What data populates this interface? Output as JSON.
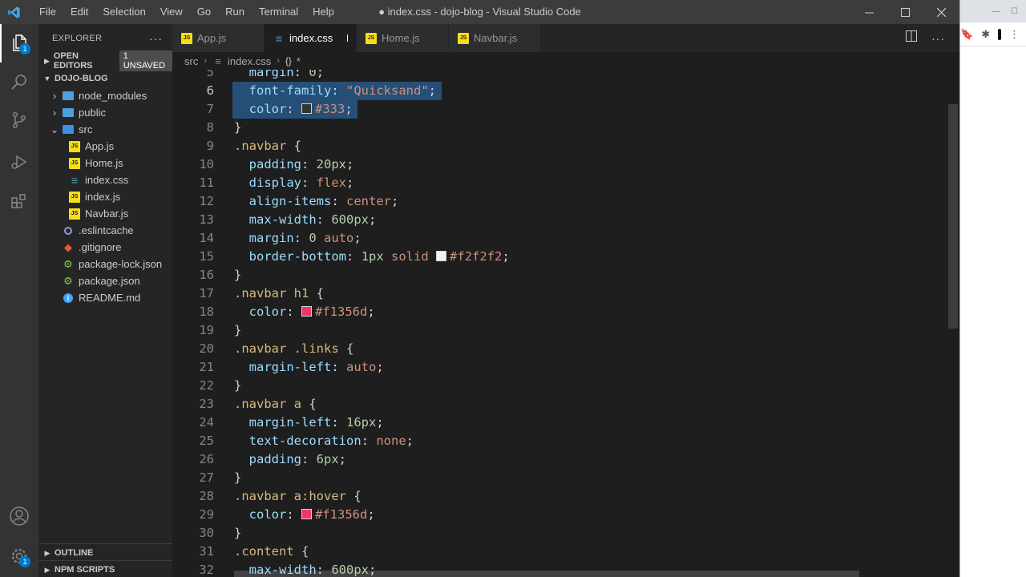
{
  "titlebar": {
    "menu": [
      "File",
      "Edit",
      "Selection",
      "View",
      "Go",
      "Run",
      "Terminal",
      "Help"
    ],
    "title": "● index.css - dojo-blog - Visual Studio Code"
  },
  "activity": {
    "explorer_badge": "1",
    "settings_badge": "1"
  },
  "sidebar": {
    "header": "EXPLORER",
    "open_editors": {
      "label": "OPEN EDITORS",
      "badge": "1 UNSAVED"
    },
    "project": "DOJO-BLOG",
    "tree": [
      {
        "label": "node_modules",
        "type": "folder",
        "depth": 1,
        "chevron": "›"
      },
      {
        "label": "public",
        "type": "folder",
        "depth": 1,
        "chevron": "›"
      },
      {
        "label": "src",
        "type": "folder-src",
        "depth": 1,
        "chevron": "⌄"
      },
      {
        "label": "App.js",
        "type": "js",
        "depth": 2
      },
      {
        "label": "Home.js",
        "type": "js",
        "depth": 2
      },
      {
        "label": "index.css",
        "type": "css",
        "depth": 2
      },
      {
        "label": "index.js",
        "type": "js",
        "depth": 2
      },
      {
        "label": "Navbar.js",
        "type": "js",
        "depth": 2
      },
      {
        "label": ".eslintcache",
        "type": "eslint",
        "depth": 1
      },
      {
        "label": ".gitignore",
        "type": "git",
        "depth": 1
      },
      {
        "label": "package-lock.json",
        "type": "npm",
        "depth": 1
      },
      {
        "label": "package.json",
        "type": "npm",
        "depth": 1
      },
      {
        "label": "README.md",
        "type": "info",
        "depth": 1
      }
    ],
    "outline": "OUTLINE",
    "npm_scripts": "NPM SCRIPTS"
  },
  "tabs": [
    {
      "label": "App.js",
      "type": "js",
      "active": false
    },
    {
      "label": "index.css",
      "type": "css",
      "active": true,
      "dirty": true
    },
    {
      "label": "Home.js",
      "type": "js",
      "active": false
    },
    {
      "label": "Navbar.js",
      "type": "js",
      "active": false
    }
  ],
  "breadcrumb": {
    "folder": "src",
    "file": "index.css",
    "symbol": "*"
  },
  "editor": {
    "current_line": 6,
    "lines": [
      {
        "n": "5",
        "indent": 1,
        "tokens": [
          [
            "prop",
            "margin"
          ],
          [
            "pun",
            ": "
          ],
          [
            "num",
            "0"
          ],
          [
            "pun",
            ";"
          ]
        ]
      },
      {
        "n": "6",
        "indent": 1,
        "sel": true,
        "tokens": [
          [
            "prop",
            "font-family"
          ],
          [
            "pun",
            ": "
          ],
          [
            "str",
            "\"Quicksand\""
          ],
          [
            "pun",
            ";"
          ]
        ]
      },
      {
        "n": "7",
        "indent": 1,
        "sel": true,
        "tokens": [
          [
            "prop",
            "color"
          ],
          [
            "pun",
            ": "
          ],
          [
            "swatch",
            "#333333"
          ],
          [
            "val",
            "#333"
          ],
          [
            "pun",
            ";"
          ]
        ]
      },
      {
        "n": "8",
        "indent": 0,
        "tokens": [
          [
            "pun",
            "}"
          ]
        ]
      },
      {
        "n": "9",
        "indent": 0,
        "tokens": [
          [
            "sel",
            ".navbar"
          ],
          [
            "pun",
            " {"
          ]
        ]
      },
      {
        "n": "10",
        "indent": 1,
        "tokens": [
          [
            "prop",
            "padding"
          ],
          [
            "pun",
            ": "
          ],
          [
            "num",
            "20px"
          ],
          [
            "pun",
            ";"
          ]
        ]
      },
      {
        "n": "11",
        "indent": 1,
        "tokens": [
          [
            "prop",
            "display"
          ],
          [
            "pun",
            ": "
          ],
          [
            "val",
            "flex"
          ],
          [
            "pun",
            ";"
          ]
        ]
      },
      {
        "n": "12",
        "indent": 1,
        "tokens": [
          [
            "prop",
            "align-items"
          ],
          [
            "pun",
            ": "
          ],
          [
            "val",
            "center"
          ],
          [
            "pun",
            ";"
          ]
        ]
      },
      {
        "n": "13",
        "indent": 1,
        "tokens": [
          [
            "prop",
            "max-width"
          ],
          [
            "pun",
            ": "
          ],
          [
            "num",
            "600px"
          ],
          [
            "pun",
            ";"
          ]
        ]
      },
      {
        "n": "14",
        "indent": 1,
        "tokens": [
          [
            "prop",
            "margin"
          ],
          [
            "pun",
            ": "
          ],
          [
            "num",
            "0"
          ],
          [
            "pun",
            " "
          ],
          [
            "val",
            "auto"
          ],
          [
            "pun",
            ";"
          ]
        ]
      },
      {
        "n": "15",
        "indent": 1,
        "tokens": [
          [
            "prop",
            "border-bottom"
          ],
          [
            "pun",
            ": "
          ],
          [
            "num",
            "1px"
          ],
          [
            "pun",
            " "
          ],
          [
            "val",
            "solid"
          ],
          [
            "pun",
            " "
          ],
          [
            "swatch",
            "#f2f2f2"
          ],
          [
            "val",
            "#f2f2f2"
          ],
          [
            "pun",
            ";"
          ]
        ]
      },
      {
        "n": "16",
        "indent": 0,
        "tokens": [
          [
            "pun",
            "}"
          ]
        ]
      },
      {
        "n": "17",
        "indent": 0,
        "tokens": [
          [
            "sel",
            ".navbar h1"
          ],
          [
            "pun",
            " {"
          ]
        ]
      },
      {
        "n": "18",
        "indent": 1,
        "tokens": [
          [
            "prop",
            "color"
          ],
          [
            "pun",
            ": "
          ],
          [
            "swatch",
            "#f1356d"
          ],
          [
            "val",
            "#f1356d"
          ],
          [
            "pun",
            ";"
          ]
        ]
      },
      {
        "n": "19",
        "indent": 0,
        "tokens": [
          [
            "pun",
            "}"
          ]
        ]
      },
      {
        "n": "20",
        "indent": 0,
        "tokens": [
          [
            "sel",
            ".navbar .links"
          ],
          [
            "pun",
            " {"
          ]
        ]
      },
      {
        "n": "21",
        "indent": 1,
        "tokens": [
          [
            "prop",
            "margin-left"
          ],
          [
            "pun",
            ": "
          ],
          [
            "val",
            "auto"
          ],
          [
            "pun",
            ";"
          ]
        ]
      },
      {
        "n": "22",
        "indent": 0,
        "tokens": [
          [
            "pun",
            "}"
          ]
        ]
      },
      {
        "n": "23",
        "indent": 0,
        "tokens": [
          [
            "sel",
            ".navbar a"
          ],
          [
            "pun",
            " {"
          ]
        ]
      },
      {
        "n": "24",
        "indent": 1,
        "tokens": [
          [
            "prop",
            "margin-left"
          ],
          [
            "pun",
            ": "
          ],
          [
            "num",
            "16px"
          ],
          [
            "pun",
            ";"
          ]
        ]
      },
      {
        "n": "25",
        "indent": 1,
        "tokens": [
          [
            "prop",
            "text-decoration"
          ],
          [
            "pun",
            ": "
          ],
          [
            "val",
            "none"
          ],
          [
            "pun",
            ";"
          ]
        ]
      },
      {
        "n": "26",
        "indent": 1,
        "tokens": [
          [
            "prop",
            "padding"
          ],
          [
            "pun",
            ": "
          ],
          [
            "num",
            "6px"
          ],
          [
            "pun",
            ";"
          ]
        ]
      },
      {
        "n": "27",
        "indent": 0,
        "tokens": [
          [
            "pun",
            "}"
          ]
        ]
      },
      {
        "n": "28",
        "indent": 0,
        "tokens": [
          [
            "sel",
            ".navbar a:hover"
          ],
          [
            "pun",
            " {"
          ]
        ]
      },
      {
        "n": "29",
        "indent": 1,
        "tokens": [
          [
            "prop",
            "color"
          ],
          [
            "pun",
            ": "
          ],
          [
            "swatch",
            "#f1356d"
          ],
          [
            "val",
            "#f1356d"
          ],
          [
            "pun",
            ";"
          ]
        ]
      },
      {
        "n": "30",
        "indent": 0,
        "tokens": [
          [
            "pun",
            "}"
          ]
        ]
      },
      {
        "n": "31",
        "indent": 0,
        "tokens": [
          [
            "sel",
            ".content"
          ],
          [
            "pun",
            " {"
          ]
        ]
      },
      {
        "n": "32",
        "indent": 1,
        "tokens": [
          [
            "prop",
            "max-width"
          ],
          [
            "pun",
            ": "
          ],
          [
            "num",
            "600px"
          ],
          [
            "pun",
            ";"
          ]
        ]
      }
    ]
  },
  "colors": {
    "accent": "#007acc",
    "selection": "#264f78"
  }
}
